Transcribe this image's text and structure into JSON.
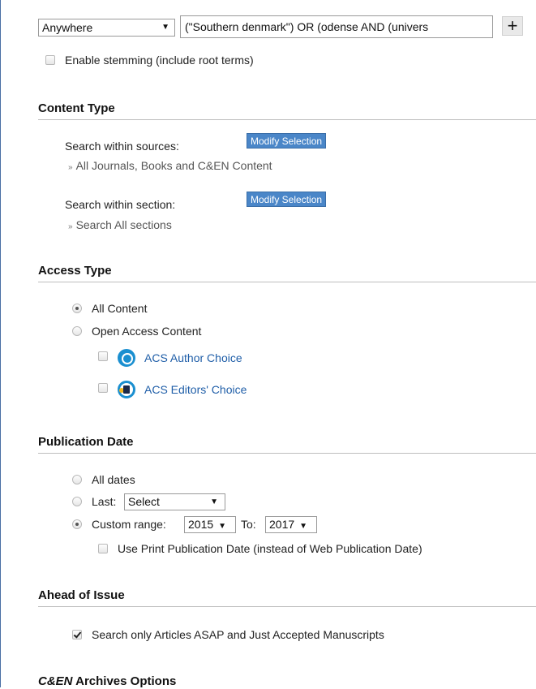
{
  "search": {
    "field_select": "Anywhere",
    "query_value": "(\"Southern denmark\") OR (odense AND (univers",
    "add_row_label": "+",
    "stemming_label": "Enable stemming (include root terms)",
    "stemming_checked": false
  },
  "content_type": {
    "heading": "Content Type",
    "sources_label": "Search within sources:",
    "sources_button": "Modify Selection",
    "sources_value": "All Journals, Books and C&EN Content",
    "section_label": "Search within section:",
    "section_button": "Modify Selection",
    "section_value": "Search All sections",
    "chevron": "»"
  },
  "access_type": {
    "heading": "Access Type",
    "all_content": "All Content",
    "open_access": "Open Access Content",
    "author_choice": "ACS Author Choice",
    "editors_choice": "ACS Editors' Choice",
    "selected": "All Content"
  },
  "publication_date": {
    "heading": "Publication Date",
    "all_dates": "All dates",
    "last_label": "Last:",
    "last_select": "Select",
    "custom_label": "Custom range:",
    "from_year": "2015",
    "to_label": "To:",
    "to_year": "2017",
    "print_date_label": "Use Print Publication Date (instead of Web Publication Date)",
    "selected": "Custom range"
  },
  "ahead_of_issue": {
    "heading": "Ahead of Issue",
    "asap_label": "Search only Articles ASAP and Just Accepted Manuscripts",
    "asap_checked": true
  },
  "cen_archives": {
    "heading_italic": "C&EN",
    "heading_rest": " Archives Options"
  },
  "icons": {
    "dropdown_arrow": "▼"
  },
  "colors": {
    "button_blue": "#4a86c8",
    "link_blue": "#1f5ea8",
    "frame_blue": "#4a6fa5"
  }
}
